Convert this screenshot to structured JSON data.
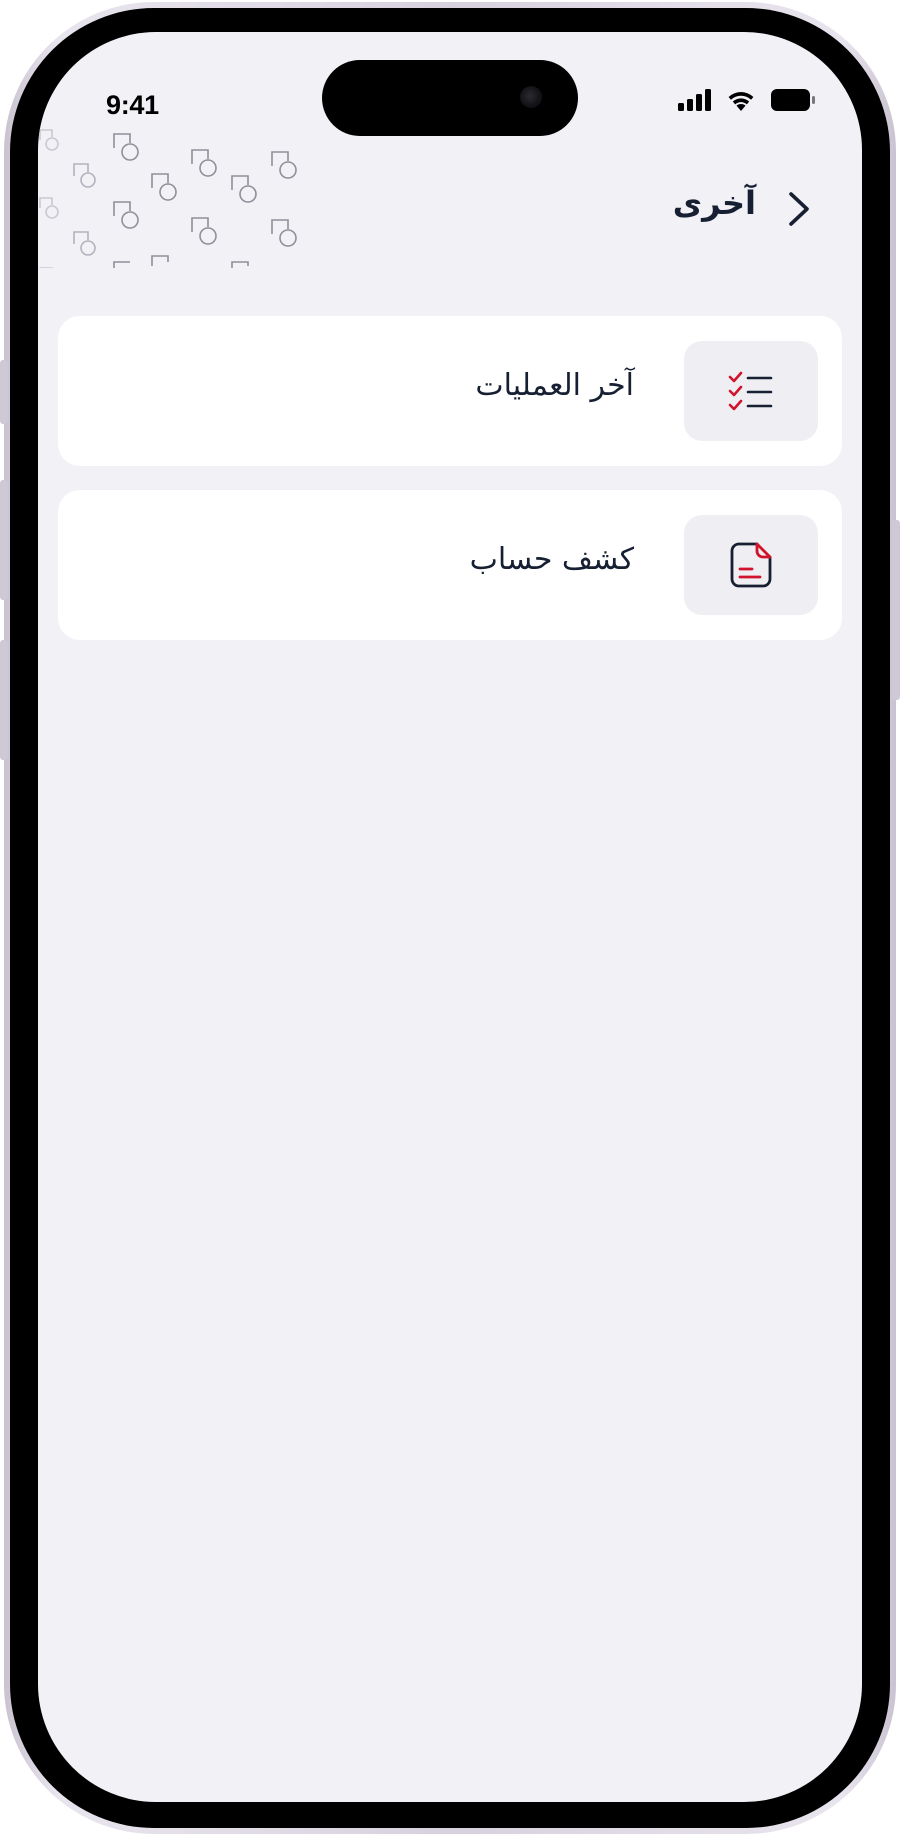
{
  "status_bar": {
    "time": "9:41",
    "icons": [
      "cellular-signal-icon",
      "wifi-icon",
      "battery-icon"
    ]
  },
  "header": {
    "title": "آخرى",
    "back_icon": "chevron-right-icon"
  },
  "menu": {
    "items": [
      {
        "label": "آخر العمليات",
        "icon": "checklist-icon"
      },
      {
        "label": "كشف حساب",
        "icon": "statement-document-icon"
      }
    ]
  },
  "colors": {
    "screen_background": "#f2f1f6",
    "card_background": "#ffffff",
    "icon_box_background": "#efeef3",
    "text_primary": "#172033",
    "accent_red": "#d0142c"
  }
}
